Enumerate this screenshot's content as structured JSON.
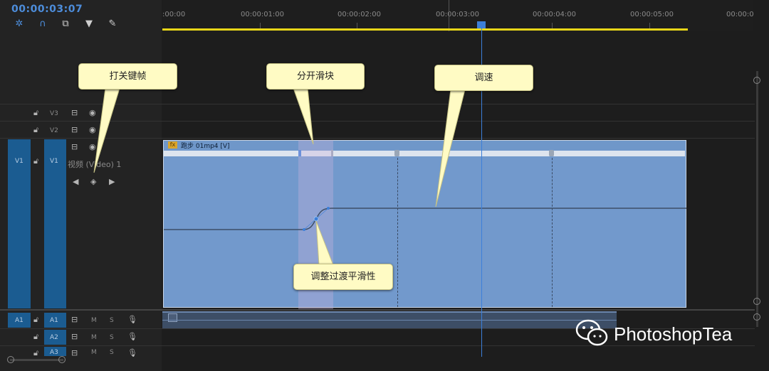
{
  "header": {
    "timecode": "00:00:03:07",
    "tools": [
      {
        "icon": "ripple-icon"
      },
      {
        "icon": "snap-magnet-icon"
      },
      {
        "icon": "linked-selection-icon"
      },
      {
        "icon": "add-marker-icon"
      },
      {
        "icon": "wrench-icon"
      }
    ]
  },
  "ruler": {
    "labels": [
      ":00:00",
      "00:00:01:00",
      "00:00:02:00",
      "00:00:03:00",
      "00:00:04:00",
      "00:00:05:00",
      "00:00:0"
    ]
  },
  "tracks": {
    "video": [
      {
        "source": "",
        "name": "V3"
      },
      {
        "source": "",
        "name": "V2"
      },
      {
        "source": "V1",
        "name": "V1",
        "label": "视频 (Video) 1"
      }
    ],
    "audio": [
      {
        "source": "A1",
        "name": "A1",
        "m": "M",
        "s": "S"
      },
      {
        "source": "",
        "name": "A2",
        "m": "M",
        "s": "S"
      },
      {
        "source": "",
        "name": "A3",
        "m": "M",
        "s": "S"
      }
    ]
  },
  "clip": {
    "fx": "fx",
    "title": "跑步 01mp4 [V]"
  },
  "callouts": {
    "keyframe": "打关键帧",
    "split_slider": "分开滑块",
    "speed": "调速",
    "smooth": "调整过渡平滑性"
  },
  "watermark": {
    "text": "PhotoshopTea",
    "icon": "wechat-icon"
  },
  "colors": {
    "accent": "#4d8ddb",
    "clip": "#7299cc",
    "workarea": "#e8d618",
    "callout_bg": "#fffbc4"
  }
}
